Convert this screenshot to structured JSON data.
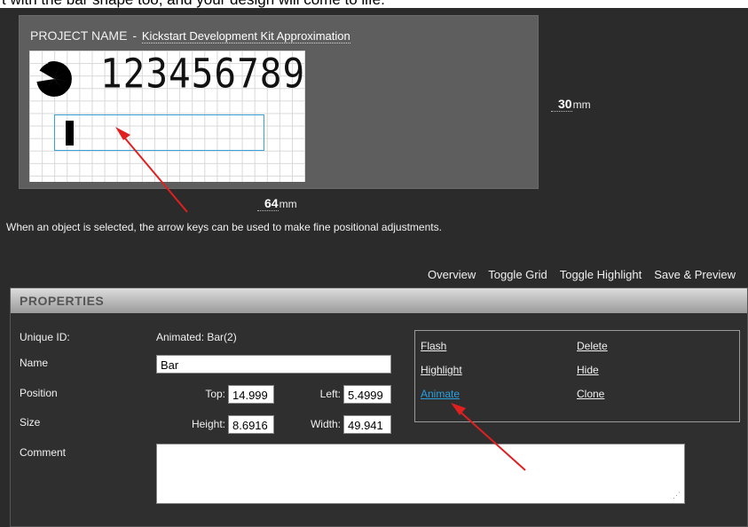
{
  "intro_text": "t with the bar shape too, and your design will come to life.",
  "project": {
    "label": "PROJECT NAME",
    "separator": "-",
    "name": "Kickstart Development Kit Approximation"
  },
  "lcd": {
    "digits": "123456789"
  },
  "dimensions": {
    "width_value": "64",
    "height_value": "30",
    "unit": "mm"
  },
  "hint": "When an object is selected, the arrow keys can be used to make fine positional adjustments.",
  "toolbar": {
    "overview": "Overview",
    "toggle_grid": "Toggle Grid",
    "toggle_highlight": "Toggle Highlight",
    "save_preview": "Save & Preview"
  },
  "properties": {
    "header": "Properties",
    "unique_id_label": "Unique ID:",
    "unique_id_value": "Animated: Bar(2)",
    "name_label": "Name",
    "name_value": "Bar",
    "position_label": "Position",
    "top_label": "Top:",
    "top_value": "14.999",
    "left_label": "Left:",
    "left_value": "5.4999",
    "size_label": "Size",
    "height_label": "Height:",
    "height_value": "8.6916",
    "width_label": "Width:",
    "width_value": "49.941",
    "comment_label": "Comment",
    "comment_value": ""
  },
  "actions": {
    "flash": "Flash",
    "highlight": "Highlight",
    "animate": "Animate",
    "delete": "Delete",
    "hide": "Hide",
    "clone": "Clone"
  },
  "colors": {
    "background": "#2b2b2b",
    "panel": "#5e5e5e",
    "link_active": "#29a0e0",
    "selection_box": "#3aa0d8",
    "annotation_arrow": "#e02020"
  }
}
